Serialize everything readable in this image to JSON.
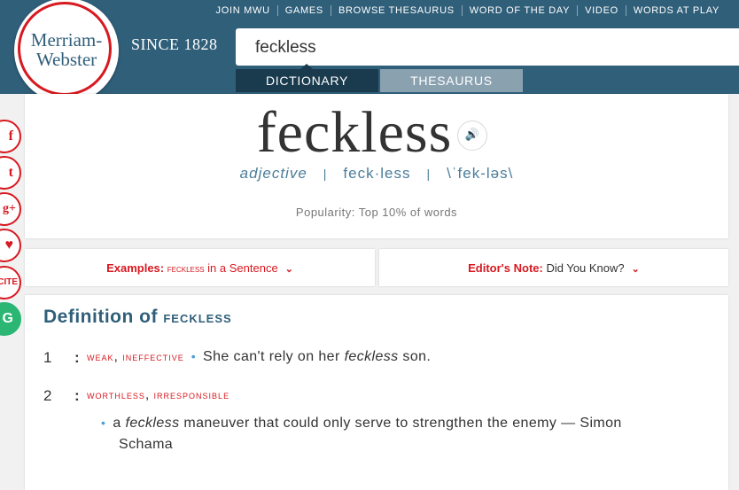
{
  "brand": {
    "logo_line1": "Merriam-",
    "logo_line2": "Webster",
    "since": "SINCE 1828"
  },
  "topnav": [
    "JOIN MWU",
    "GAMES",
    "BROWSE THESAURUS",
    "WORD OF THE DAY",
    "VIDEO",
    "WORDS AT PLAY"
  ],
  "search": {
    "value": "feckless"
  },
  "tabs": {
    "dictionary": "DICTIONARY",
    "thesaurus": "THESAURUS"
  },
  "social": {
    "facebook": "f",
    "twitter": "t",
    "googleplus": "g+",
    "heart": "♥",
    "cite": "CITE",
    "grammarly": "G"
  },
  "entry": {
    "word": "feckless",
    "audio_icon": "🔊",
    "pos": "adjective",
    "syllables": "feck·less",
    "pronunciation": "\\ˈfek-ləs\\",
    "popularity": "Popularity: Top 10% of words"
  },
  "panels": {
    "examples_label": "Examples:",
    "examples_word": "feckless",
    "examples_rest": "in a Sentence",
    "editors_label": "Editor's Note:",
    "editors_rest": "Did You Know?"
  },
  "definition": {
    "title_prefix": "Definition of",
    "title_word": "feckless",
    "senses": [
      {
        "num": "1",
        "syn1": "weak",
        "syn2": "ineffective",
        "ex_pre": "She can't rely on her",
        "ex_word": "feckless",
        "ex_post": "son."
      },
      {
        "num": "2",
        "syn1": "worthless",
        "syn2": "irresponsible",
        "ex_pre": "a",
        "ex_word": "feckless",
        "ex_post": "maneuver that could only serve to strengthen the enemy — Simon",
        "ex_line2": "Schama"
      }
    ]
  },
  "colors": {
    "header": "#305f7a",
    "accent_red": "#d71920",
    "link_blue": "#4a7d9a"
  }
}
